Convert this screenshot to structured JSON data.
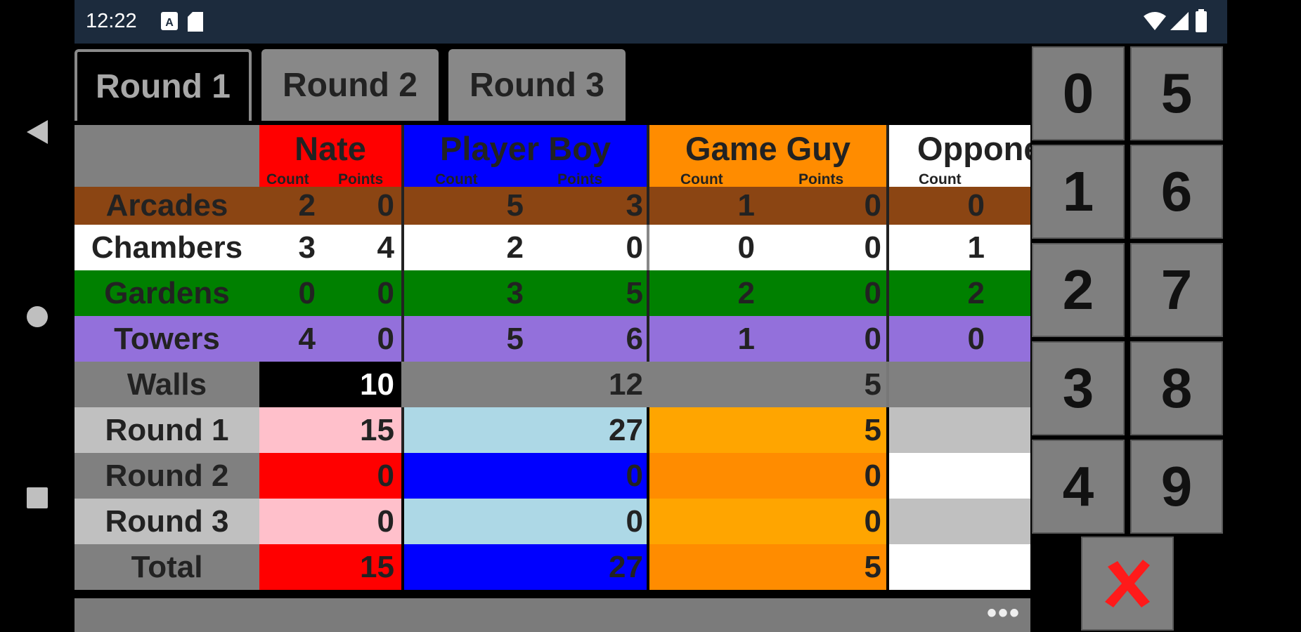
{
  "status_bar": {
    "time": "12:22"
  },
  "tabs": [
    {
      "label": "Round 1",
      "active": true
    },
    {
      "label": "Round 2",
      "active": false
    },
    {
      "label": "Round 3",
      "active": false
    }
  ],
  "players": [
    {
      "name": "Nate",
      "count_label": "Count",
      "points_label": "Points",
      "color": "#ff0000"
    },
    {
      "name": "Player Boy",
      "count_label": "Count",
      "points_label": "Points",
      "color": "#0000ff"
    },
    {
      "name": "Game Guy",
      "count_label": "Count",
      "points_label": "Points",
      "color": "#ff8c00"
    },
    {
      "name": "Opponent",
      "count_label": "Count",
      "points_label": "",
      "color": "#ffffff"
    }
  ],
  "rows": {
    "arcades": {
      "label": "Arcades",
      "values": [
        [
          "2",
          "0"
        ],
        [
          "5",
          "3"
        ],
        [
          "1",
          "0"
        ],
        [
          "0",
          ""
        ]
      ],
      "color": "#8b4513"
    },
    "chambers": {
      "label": "Chambers",
      "values": [
        [
          "3",
          "4"
        ],
        [
          "2",
          "0"
        ],
        [
          "0",
          "0"
        ],
        [
          "1",
          ""
        ]
      ],
      "color": "#ffffff"
    },
    "gardens": {
      "label": "Gardens",
      "values": [
        [
          "0",
          "0"
        ],
        [
          "3",
          "5"
        ],
        [
          "2",
          "0"
        ],
        [
          "2",
          ""
        ]
      ],
      "color": "#008000"
    },
    "towers": {
      "label": "Towers",
      "values": [
        [
          "4",
          "0"
        ],
        [
          "5",
          "6"
        ],
        [
          "1",
          "0"
        ],
        [
          "0",
          ""
        ]
      ],
      "color": "#9370db"
    },
    "walls": {
      "label": "Walls",
      "values": [
        "10",
        "12",
        "5",
        ""
      ]
    },
    "round1": {
      "label": "Round 1",
      "values": [
        "15",
        "27",
        "5",
        ""
      ]
    },
    "round2": {
      "label": "Round 2",
      "values": [
        "0",
        "0",
        "0",
        ""
      ]
    },
    "round3": {
      "label": "Round 3",
      "values": [
        "0",
        "0",
        "0",
        ""
      ]
    },
    "total": {
      "label": "Total",
      "values": [
        "15",
        "27",
        "5",
        ""
      ]
    }
  },
  "keypad": {
    "keys": [
      "0",
      "5",
      "1",
      "6",
      "2",
      "7",
      "3",
      "8",
      "4",
      "9"
    ],
    "clear_icon": "red-x-icon"
  },
  "bottom_bar": {
    "overflow_label": "•••"
  }
}
